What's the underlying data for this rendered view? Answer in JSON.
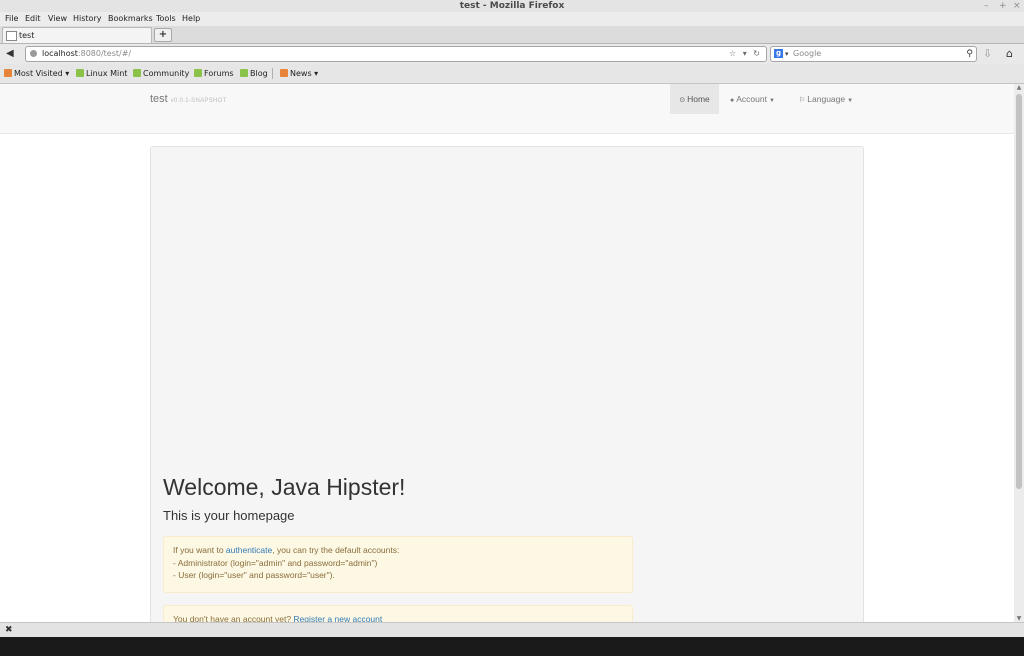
{
  "window": {
    "title": "test - Mozilla Firefox",
    "controls": [
      "–",
      "+",
      "×"
    ]
  },
  "menubar": {
    "items": [
      "File",
      "Edit",
      "View",
      "History",
      "Bookmarks",
      "Tools",
      "Help"
    ]
  },
  "tabs": {
    "active_label": "test",
    "new_tab": "+"
  },
  "navbar": {
    "url_host": "localhost",
    "url_rest": ":8080/test/#/",
    "url_icons": "☆ ▾ ↻",
    "search_placeholder": "Google",
    "search_engine": "g"
  },
  "bookmarks": [
    {
      "label": "Most Visited ▾",
      "icon": "orange"
    },
    {
      "label": "Linux Mint",
      "icon": "green"
    },
    {
      "label": "Community",
      "icon": "green"
    },
    {
      "label": "Forums",
      "icon": "green"
    },
    {
      "label": "Blog",
      "icon": "green"
    },
    {
      "label": "News ▾",
      "icon": "orange"
    }
  ],
  "app": {
    "brand": "test",
    "version": "v0.0.1-SNAPSHOT",
    "nav": {
      "home": "Home",
      "account": "Account",
      "language": "Language"
    },
    "hero_title": "Welcome, Java Hipster!",
    "hero_subtitle": "This is your homepage",
    "alert1": {
      "pre": "If you want to ",
      "link": "authenticate",
      "post": ", you can try the default accounts:",
      "line2": "- Administrator (login=\"admin\" and password=\"admin\")",
      "line3": "- User (login=\"user\" and password=\"user\")."
    },
    "alert2": {
      "pre": "You don't have an account yet? ",
      "link": "Register a new account"
    }
  },
  "statusbar": {
    "close": "✖"
  },
  "colors": {
    "accent": "#337ab7",
    "alert_bg": "#fcf8e3",
    "alert_text": "#8a6d3b"
  }
}
